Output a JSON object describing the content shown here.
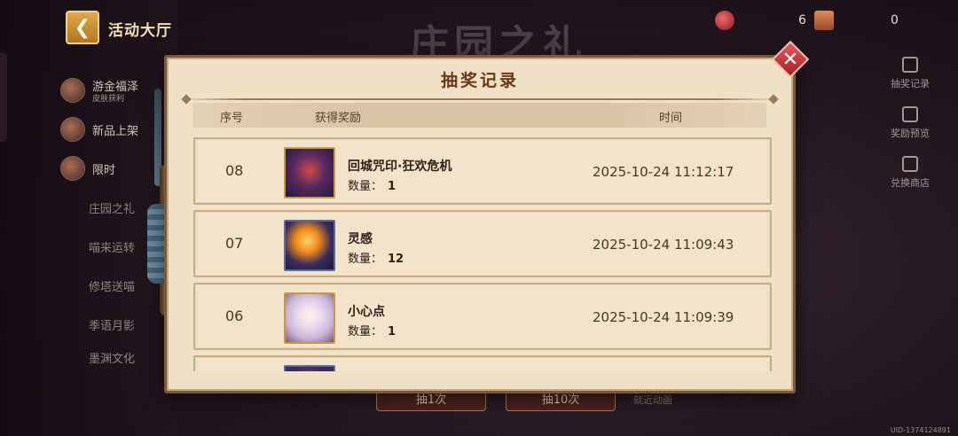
{
  "topbar": {
    "back_icon": "chevron-left-icon",
    "hall_title": "活动大厅",
    "bg_title": "庄园之礼",
    "currency_1": {
      "icon": "red-gem-icon",
      "value": "6",
      "color": "#c23a3a"
    },
    "currency_2": {
      "icon": "ticket-icon",
      "value": "0",
      "color": "#c9734a"
    }
  },
  "left_menu": {
    "items": [
      {
        "label": "游金福泽",
        "sub": "皮肤获利"
      },
      {
        "label": "新品上架"
      },
      {
        "label": "限时"
      },
      {
        "label": "庄园之礼"
      },
      {
        "label": "喵来运转"
      },
      {
        "label": "修塔送喵"
      },
      {
        "label": "季语月影"
      },
      {
        "label": "墨渊文化"
      }
    ]
  },
  "right_menu": {
    "items": [
      {
        "label": "抽奖记录",
        "icon": "gift-icon"
      },
      {
        "label": "奖励预览",
        "icon": "document-icon"
      },
      {
        "label": "兑换商店",
        "icon": "shop-icon"
      }
    ]
  },
  "modal": {
    "title": "抽奖记录",
    "headers": {
      "index": "序号",
      "reward": "获得奖励",
      "time": "时间"
    },
    "qty_label": "数量：",
    "rows": [
      {
        "index": "08",
        "name": "回城咒印·狂欢危机",
        "qty": "1",
        "time": "2025-10-24 11:12:17",
        "thumb": "cursed-seal-art"
      },
      {
        "index": "07",
        "name": "灵感",
        "qty": "12",
        "time": "2025-10-24 11:09:43",
        "thumb": "lightbulb-icon"
      },
      {
        "index": "06",
        "name": "小心点",
        "qty": "1",
        "time": "2025-10-24 11:09:39",
        "thumb": "chibi-character-art"
      },
      {
        "index": "",
        "name": "",
        "qty": "",
        "time": "",
        "thumb": "partial-item-art"
      }
    ]
  },
  "bottom": {
    "draw_one": "抽1次",
    "draw_ten": "抽10次",
    "note": "就近动画",
    "uid": "UID-1374124891"
  },
  "colors": {
    "modal_bg": "#efe0c6",
    "title_text": "#6a3a14",
    "close_red": "#c62a2e"
  }
}
